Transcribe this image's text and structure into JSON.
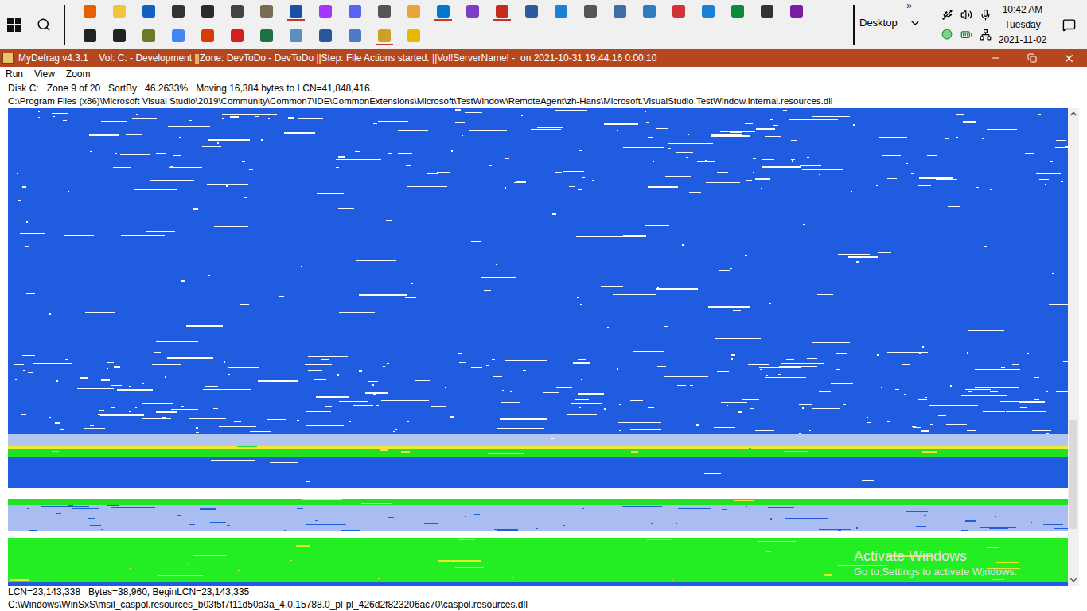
{
  "taskbar": {
    "row1": [
      {
        "color": "#e66000",
        "running": false
      },
      {
        "color": "#f3c33a",
        "running": false
      },
      {
        "color": "#0f62c4",
        "running": false
      },
      {
        "color": "#333333",
        "running": false
      },
      {
        "color": "#2b2b2b",
        "running": false
      },
      {
        "color": "#444444",
        "running": false
      },
      {
        "color": "#7a6a4f",
        "running": false
      },
      {
        "color": "#1a4fa8",
        "running": true
      },
      {
        "color": "#a334fa",
        "running": false
      },
      {
        "color": "#5865f2",
        "running": false
      },
      {
        "color": "#555555",
        "running": false
      },
      {
        "color": "#e8a33c",
        "running": false
      },
      {
        "color": "#0078d4",
        "running": true
      },
      {
        "color": "#7b3fc4",
        "running": false
      },
      {
        "color": "#c42b1c",
        "running": true
      },
      {
        "color": "#2c5aa0",
        "running": false
      },
      {
        "color": "#1f7fd6",
        "running": false
      },
      {
        "color": "#555555",
        "running": false
      },
      {
        "color": "#3a6fa8",
        "running": false
      },
      {
        "color": "#2f7bbf",
        "running": false
      },
      {
        "color": "#d13438",
        "running": false
      },
      {
        "color": "#1a7fd6",
        "running": false
      },
      {
        "color": "#0f8a3c",
        "running": false
      },
      {
        "color": "#333333",
        "running": false
      },
      {
        "color": "#7a1fa2",
        "running": false
      }
    ],
    "row2": [
      {
        "color": "#222222",
        "running": false
      },
      {
        "color": "#222222",
        "running": false
      },
      {
        "color": "#6a7a2c",
        "running": false
      },
      {
        "color": "#4285f4",
        "running": false
      },
      {
        "color": "#d83b01",
        "running": false
      },
      {
        "color": "#d4201c",
        "running": false
      },
      {
        "color": "#1e7145",
        "running": false
      },
      {
        "color": "#5b8fbf",
        "running": false
      },
      {
        "color": "#2b579a",
        "running": false
      },
      {
        "color": "#4a7cc4",
        "running": false
      },
      {
        "color": "#c9a227",
        "running": true
      },
      {
        "color": "#e6b800",
        "running": false
      }
    ],
    "overflow": "»",
    "toolbar": "Desktop",
    "clock": {
      "time": "10:42 AM",
      "day": "Tuesday",
      "date": "2021-11-02"
    }
  },
  "window": {
    "title": "MyDefrag v4.3.1    Vol: C: - Development ||Zone: DevToDo - DevToDo ||Step: File Actions started. ||Vol!ServerName! -  on 2021-10-31 19:44:16 0:00:10"
  },
  "menu": [
    "Run",
    "View",
    "Zoom"
  ],
  "status": {
    "fields": [
      "Disk C:",
      "Zone 9 of 20",
      "SortBy",
      "46.2633%",
      "Moving 16,384 bytes to LCN=41,848,416."
    ],
    "path": "C:\\Program Files (x86)\\Microsoft Visual Studio\\2019\\Community\\Common7\\IDE\\CommonExtensions\\Microsoft\\TestWindow\\RemoteAgent\\zh-Hans\\Microsoft.VisualStudio.TestWindow.Internal.resources.dll"
  },
  "disk_map": {
    "bands": [
      {
        "color": "#1f5ce0",
        "clusters": 105,
        "fragmentation": 0.7,
        "speck_color": "#ffffff"
      },
      {
        "color": "#1f5ce0",
        "clusters": 200,
        "fragmentation": 0.15,
        "speck_color": "#ffffff"
      },
      {
        "color": "#1f5ce0",
        "clusters": 104,
        "fragmentation": 0.9,
        "speck_color": "#ffffff"
      },
      {
        "color": "#b3c6f0",
        "clusters": 15,
        "fragmentation": 0.1,
        "speck_color": "#ffffff"
      },
      {
        "color": "#f2e833",
        "clusters": 4,
        "fragmentation": 0.3,
        "speck_color": "#22e022"
      },
      {
        "color": "#22e022",
        "clusters": 11,
        "fragmentation": 0.3,
        "speck_color": "#f2e833"
      },
      {
        "color": "#1f5ce0",
        "clusters": 38,
        "fragmentation": 0.05,
        "speck_color": "#ffffff"
      },
      {
        "color": "#ffffff",
        "clusters": 14,
        "fragmentation": 0,
        "speck_color": "#ffffff"
      },
      {
        "color": "#22e022",
        "clusters": 8,
        "fragmentation": 0.2,
        "speck_color": "#f2e833"
      },
      {
        "color": "#a9bdf0",
        "clusters": 33,
        "fragmentation": 0.8,
        "speck_color": "#1f5ce0"
      },
      {
        "color": "#ffffff",
        "clusters": 8,
        "fragmentation": 0,
        "speck_color": "#ffffff"
      },
      {
        "color": "#22ee22",
        "clusters": 56,
        "fragmentation": 0.2,
        "speck_color": "#e8e82a"
      },
      {
        "color": "#1f5ce0",
        "clusters": 4,
        "fragmentation": 0,
        "speck_color": "#ffffff"
      }
    ],
    "scrollbar": {
      "thumb_start": 0.66,
      "thumb_size": 0.24
    },
    "watermark": {
      "title": "Activate Windows",
      "subtitle": "Go to Settings to activate Windows."
    }
  },
  "footer": {
    "fields": [
      "LCN=23,143,338",
      "Bytes=38,960, BeginLCN=23,143,335"
    ],
    "path": "C:\\Windows\\WinSxS\\msil_caspol.resources_b03f5f7f11d50a3a_4.0.15788.0_pl-pl_426d2f823206ac70\\caspol.resources.dll"
  }
}
